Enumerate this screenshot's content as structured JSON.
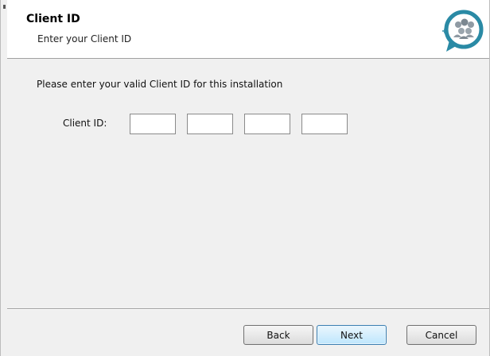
{
  "header": {
    "title": "Client ID",
    "subtitle": "Enter your Client ID"
  },
  "main": {
    "instruction": "Please enter your valid Client ID for this installation",
    "client_id_label": "Client ID:",
    "client_id_fields": [
      "",
      "",
      "",
      ""
    ]
  },
  "footer": {
    "back_label": "Back",
    "next_label": "Next",
    "cancel_label": "Cancel"
  },
  "icons": {
    "logo": "people-chat-bubble-icon"
  },
  "colors": {
    "logo_teal": "#2a8aa5",
    "logo_people": "#8f9aa3"
  }
}
